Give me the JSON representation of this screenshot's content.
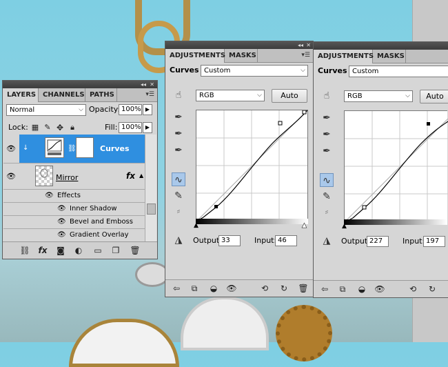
{
  "layers_panel": {
    "tabs": [
      "LAYERS",
      "CHANNELS",
      "PATHS"
    ],
    "blend_mode": "Normal",
    "opacity_label": "Opacity:",
    "opacity_value": "100%",
    "lock_label": "Lock:",
    "fill_label": "Fill:",
    "fill_value": "100%",
    "layers": [
      {
        "name": "Curves",
        "selected": true
      },
      {
        "name": "Mirror",
        "fx": "fx"
      }
    ],
    "effects_label": "Effects",
    "effects": [
      "Inner Shadow",
      "Bevel and Emboss",
      "Gradient Overlay"
    ]
  },
  "adjust_left": {
    "tabs": [
      "ADJUSTMENTS",
      "MASKS"
    ],
    "title": "Curves",
    "preset": "Custom",
    "channel": "RGB",
    "auto_label": "Auto",
    "output_label": "Output:",
    "output_value": "33",
    "input_label": "Input:",
    "input_value": "46"
  },
  "adjust_right": {
    "tabs": [
      "ADJUSTMENTS",
      "MASKS"
    ],
    "title": "Curves",
    "preset": "Custom",
    "channel": "RGB",
    "auto_label": "Auto",
    "output_label": "Output:",
    "output_value": "227",
    "input_label": "Input:",
    "input_value": "197"
  },
  "colors": {
    "selection": "#2f8fe0",
    "panel": "#d6d6d6",
    "tool_selected": "#a9c8ea"
  }
}
